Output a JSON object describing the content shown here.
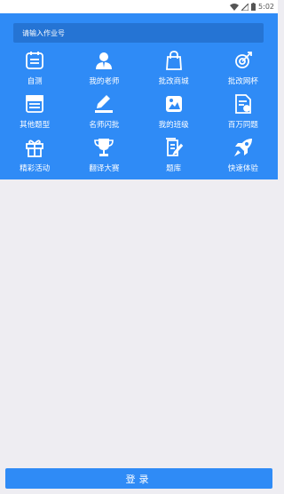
{
  "status_bar": {
    "time": "5:02"
  },
  "search": {
    "placeholder": "请输入作业号"
  },
  "grid": {
    "items": [
      {
        "label": "自测",
        "icon": "calendar-icon"
      },
      {
        "label": "我的老师",
        "icon": "teacher-icon"
      },
      {
        "label": "批改商城",
        "icon": "shopping-bag-icon"
      },
      {
        "label": "批改网杯",
        "icon": "target-icon"
      },
      {
        "label": "其他题型",
        "icon": "window-icon"
      },
      {
        "label": "名师闪批",
        "icon": "pen-icon"
      },
      {
        "label": "我的班级",
        "icon": "class-icon"
      },
      {
        "label": "百万同题",
        "icon": "document-icon"
      },
      {
        "label": "精彩活动",
        "icon": "gift-icon"
      },
      {
        "label": "翻译大赛",
        "icon": "trophy-icon"
      },
      {
        "label": "题库",
        "icon": "edit-list-icon"
      },
      {
        "label": "快速体验",
        "icon": "rocket-icon"
      }
    ]
  },
  "login": {
    "label": "登录"
  },
  "colors": {
    "primary": "#2F8BF6",
    "search_bg": "#2574D4",
    "page_bg": "#EEEDF2"
  }
}
